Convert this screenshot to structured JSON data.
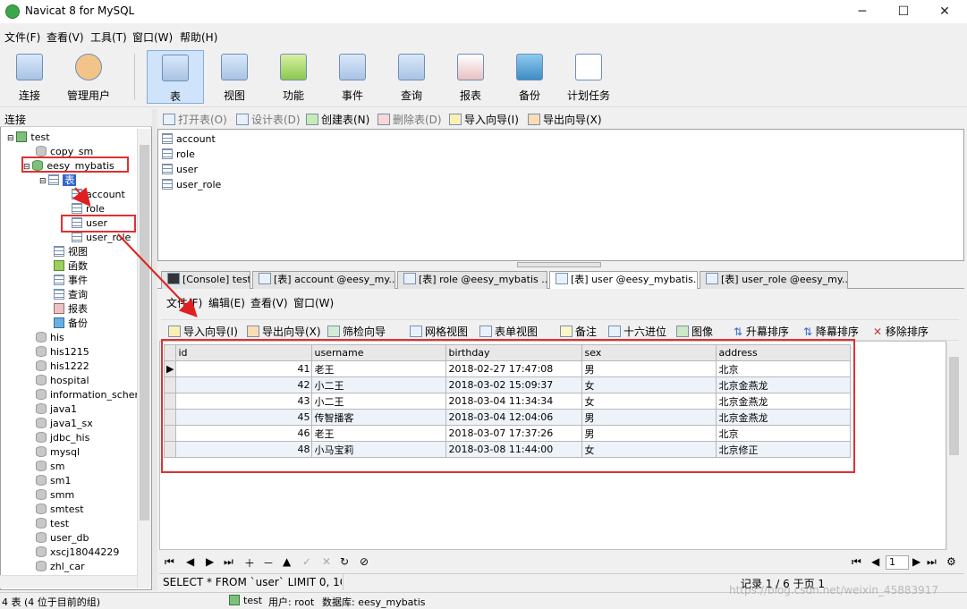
{
  "window": {
    "title": "Navicat 8 for MySQL",
    "min": "─",
    "max": "☐",
    "close": "✕"
  },
  "menu": [
    "文件(F)",
    "查看(V)",
    "工具(T)",
    "窗口(W)",
    "帮助(H)"
  ],
  "toolbar": [
    "连接",
    "管理用户",
    "表",
    "视图",
    "功能",
    "事件",
    "查询",
    "报表",
    "备份",
    "计划任务"
  ],
  "tree": {
    "header": "连接",
    "connection": "test",
    "db_copy": "copy_sm",
    "db_open": "eesy_mybatis",
    "tables_node": "表",
    "tables": [
      "account",
      "role",
      "user",
      "user_role"
    ],
    "groups": [
      "视图",
      "函数",
      "事件",
      "查询",
      "报表",
      "备份"
    ],
    "dbs": [
      "his",
      "his1215",
      "his1222",
      "hospital",
      "information_schem",
      "java1",
      "java1_sx",
      "jdbc_his",
      "mysql",
      "sm",
      "sm1",
      "smm",
      "smtest",
      "test",
      "user_db",
      "xscj18044229",
      "zhl_car"
    ]
  },
  "objbar": {
    "open": "打开表(O)",
    "design": "设计表(D)",
    "create": "创建表(N)",
    "delete": "删除表(D)",
    "import": "导入向导(I)",
    "export": "导出向导(X)"
  },
  "objlist": [
    "account",
    "role",
    "user",
    "user_role"
  ],
  "tabs": [
    "[Console] test",
    "[表] account @eesy_my...",
    "[表] role @eesy_mybatis ...",
    "[表] user @eesy_mybatis...",
    "[表] user_role @eesy_my..."
  ],
  "datamenu": [
    "文件(F)",
    "编辑(E)",
    "查看(V)",
    "窗口(W)"
  ],
  "datatool": {
    "import": "导入向导(I)",
    "export": "导出向导(X)",
    "filter": "筛检向导",
    "gridview": "网格视图",
    "formview": "表单视图",
    "memo": "备注",
    "hex": "十六进位",
    "image": "图像",
    "asc": "升幕排序",
    "desc": "降幕排序",
    "remove": "移除排序"
  },
  "grid": {
    "columns": [
      "id",
      "username",
      "birthday",
      "sex",
      "address"
    ],
    "rows": [
      [
        "41",
        "老王",
        "2018-02-27 17:47:08",
        "男",
        "北京"
      ],
      [
        "42",
        "小二王",
        "2018-03-02 15:09:37",
        "女",
        "北京金燕龙"
      ],
      [
        "43",
        "小二王",
        "2018-03-04 11:34:34",
        "女",
        "北京金燕龙"
      ],
      [
        "45",
        "传智播客",
        "2018-03-04 12:04:06",
        "男",
        "北京金燕龙"
      ],
      [
        "46",
        "老王",
        "2018-03-07 17:37:26",
        "男",
        "北京"
      ],
      [
        "48",
        "小马宝莉",
        "2018-03-08 11:44:00",
        "女",
        "北京修正"
      ]
    ]
  },
  "nav": {
    "record": "记录 1 / 6 于页 1",
    "page": "1"
  },
  "sql": "SELECT * FROM `user` LIMIT 0, 1C",
  "status": {
    "left": "4 表 (4 位于目前的组)",
    "conn": "test",
    "user": "用户: root",
    "db": "数据库: eesy_mybatis"
  },
  "watermark": "https://blog.csdn.net/weixin_45883917"
}
